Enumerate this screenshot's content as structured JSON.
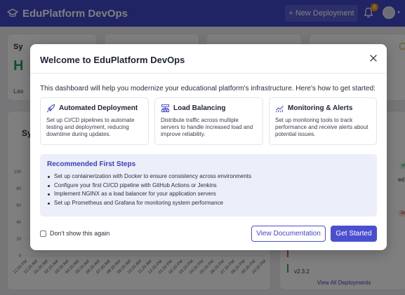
{
  "app": {
    "title": "EduPlatform DevOps",
    "new_deployment_label": "+ New Deployment",
    "notification_count": "2"
  },
  "background": {
    "status_card_title": "Sy",
    "status_value": "H",
    "status_footer": "Las",
    "section_title": "Sy",
    "success_badge": "ess",
    "failed_badge": "iled",
    "deployment_text": "ed",
    "version": "v2.3.2",
    "view_all_label": "View All Deployments",
    "chart_y_ticks": [
      "100",
      "80",
      "60",
      "40",
      "20",
      "0"
    ],
    "chart_x_ticks": [
      "11:20 PM",
      "12:20 AM",
      "01:20 AM",
      "02:20 AM",
      "03:20 AM",
      "04:20 AM",
      "05:20 AM",
      "06:20 AM",
      "07:20 AM",
      "08:20 AM",
      "09:20 AM",
      "10:20 AM",
      "11:20 AM",
      "12:20 PM",
      "01:20 PM",
      "02:20 PM",
      "03:20 PM",
      "04:20 PM",
      "05:20 PM",
      "06:20 PM",
      "07:20 PM",
      "08:20 PM",
      "09:20 PM",
      "10:20 PM"
    ]
  },
  "modal": {
    "title": "Welcome to EduPlatform DevOps",
    "intro": "This dashboard will help you modernize your educational platform's infrastructure. Here's how to get started:",
    "features": [
      {
        "icon": "rocket-icon",
        "title": "Automated Deployment",
        "description": "Set up CI/CD pipelines to automate testing and deployment, reducing downtime during updates."
      },
      {
        "icon": "load-balancer-icon",
        "title": "Load Balancing",
        "description": "Distribute traffic across multiple servers to handle increased load and improve reliability."
      },
      {
        "icon": "chart-line-icon",
        "title": "Monitoring & Alerts",
        "description": "Set up monitoring tools to track performance and receive alerts about potential issues."
      }
    ],
    "steps_title": "Recommended First Steps",
    "steps": [
      "Set up containerization with Docker to ensure consistency across environments",
      "Configure your first CI/CD pipeline with GitHub Actions or Jenkins",
      "Implement NGINX as a load balancer for your application servers",
      "Set up Prometheus and Grafana for monitoring system performance"
    ],
    "dont_show_label": "Don't show this again",
    "view_docs_label": "View Documentation",
    "get_started_label": "Get Started"
  },
  "colors": {
    "brand": "#4046c9",
    "accent": "#4a4fd0",
    "success": "#27a35a",
    "danger": "#d9534f"
  }
}
